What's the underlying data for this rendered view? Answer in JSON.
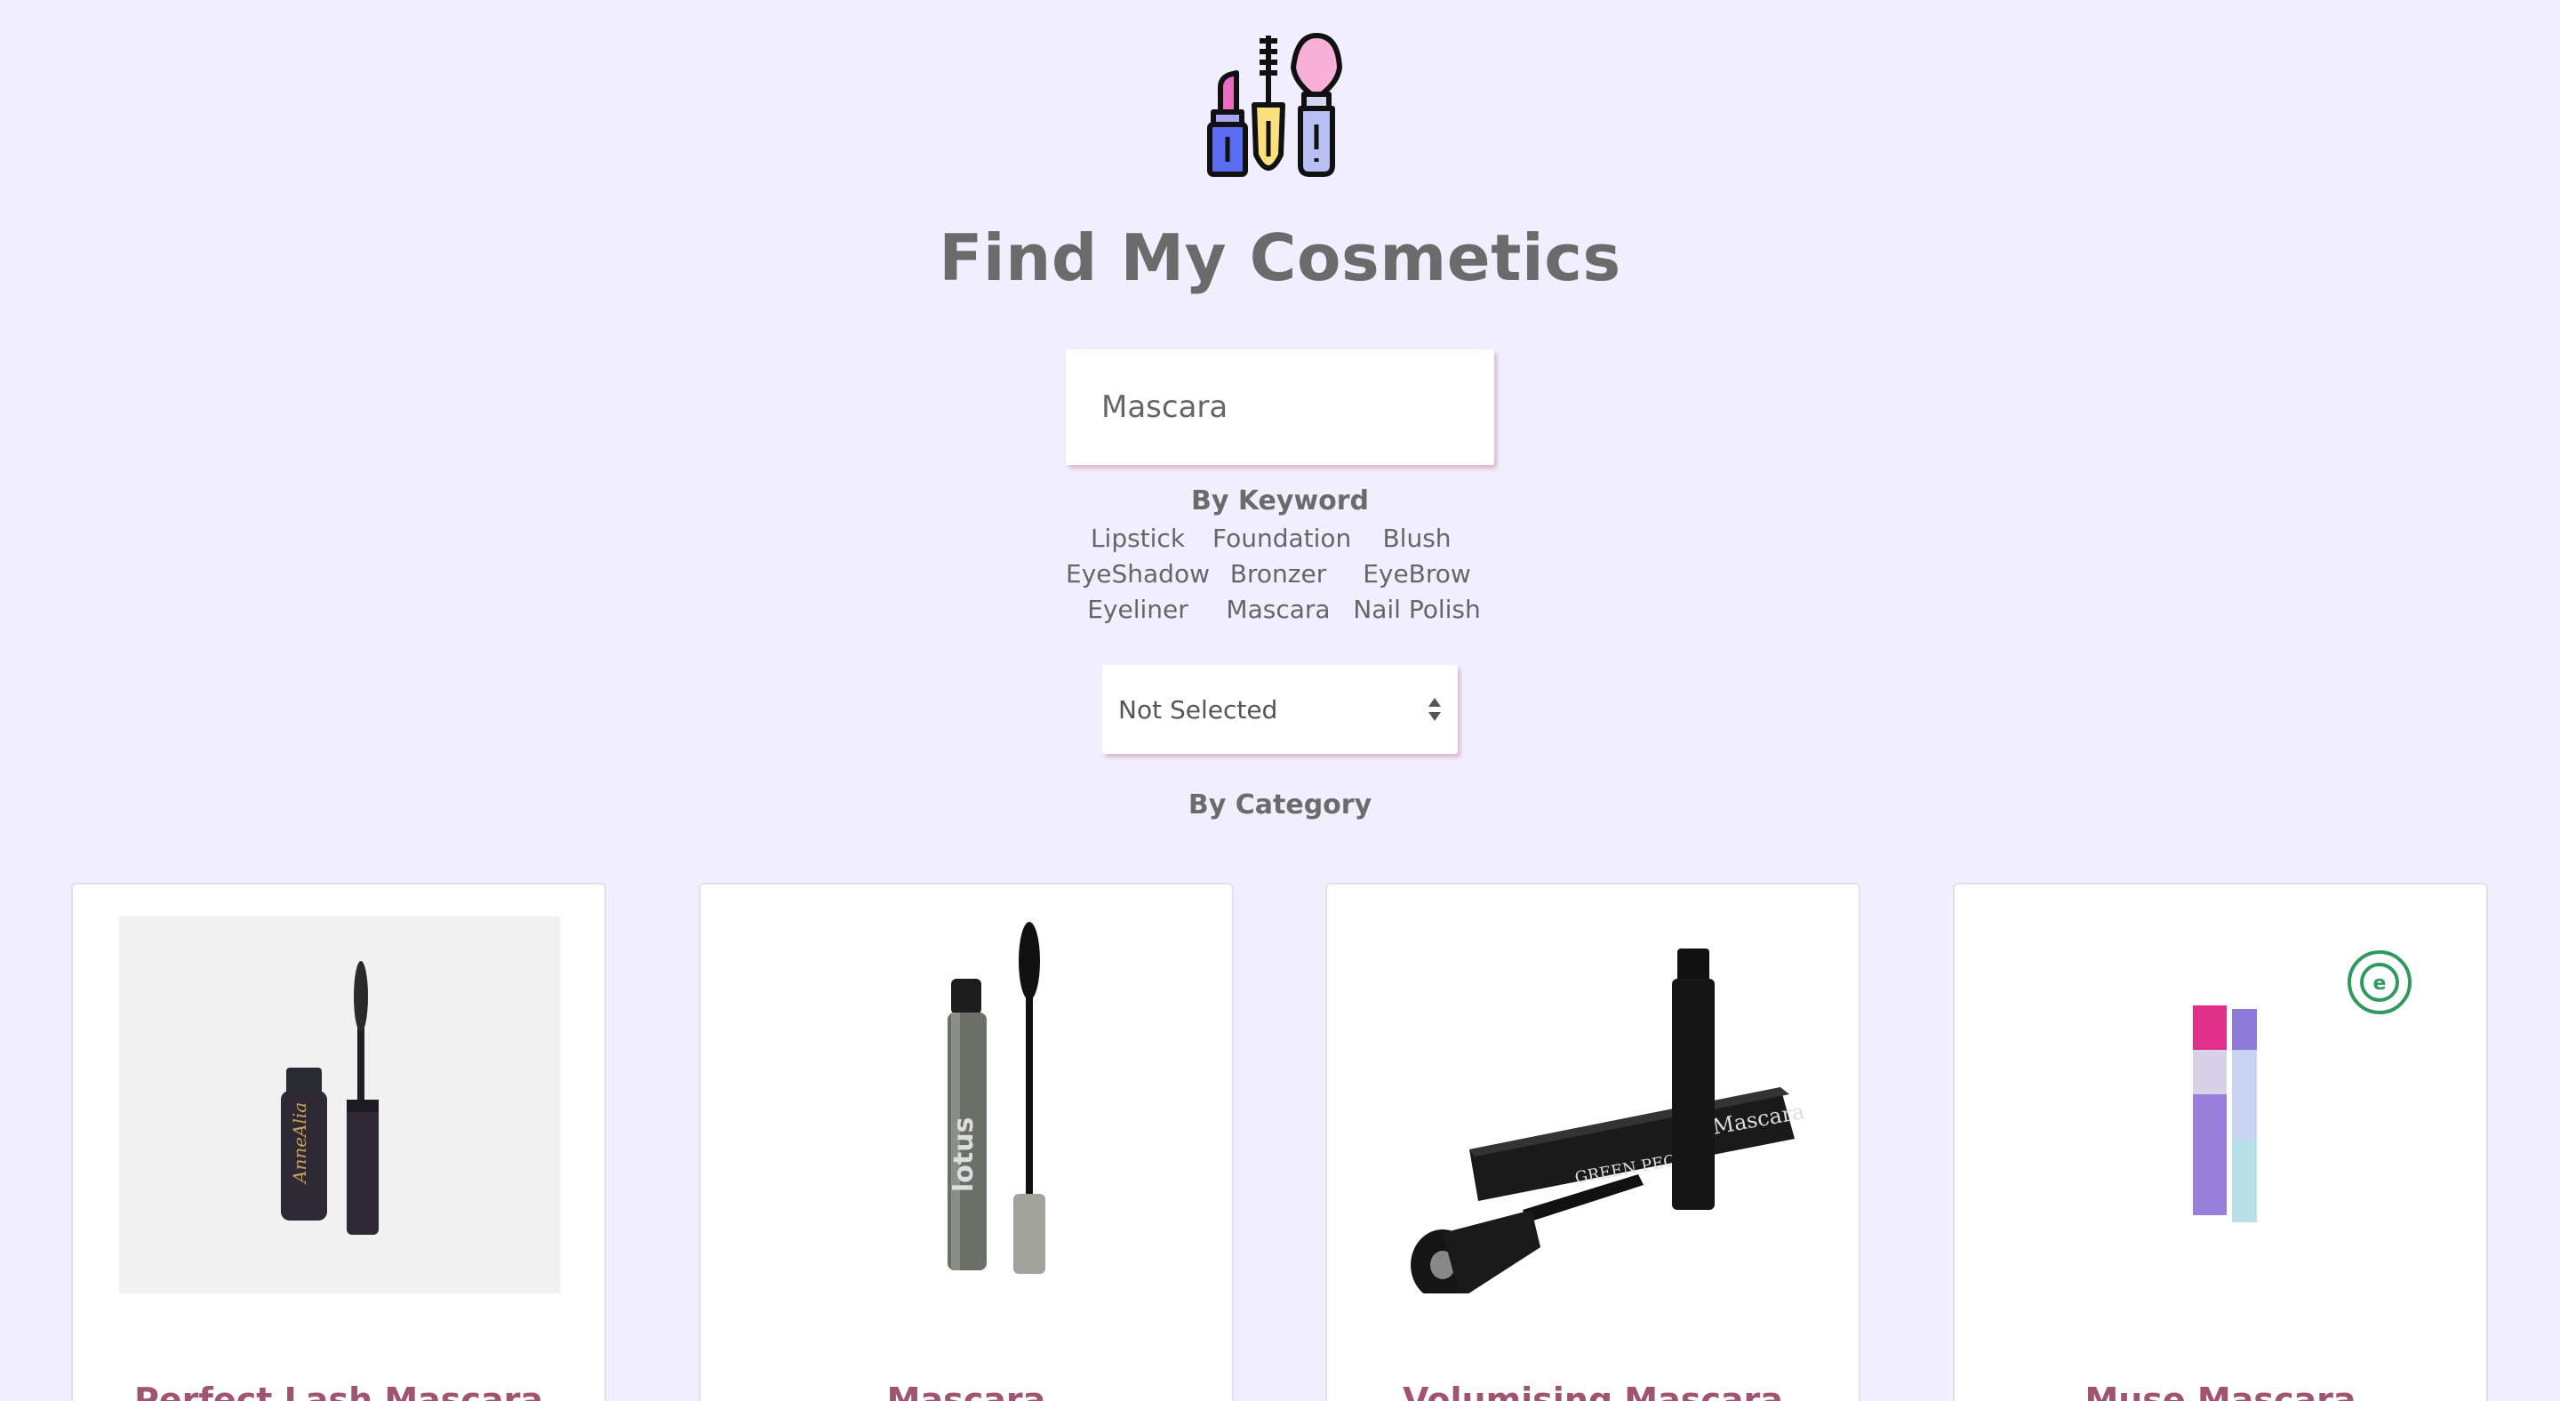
{
  "header": {
    "logo_icon": "makeup-logo-icon",
    "title": "Find My Cosmetics"
  },
  "search": {
    "value": "Mascara",
    "keyword_heading": "By Keyword",
    "keywords": [
      "Lipstick",
      "Foundation",
      "Blush",
      "EyeShadow",
      "Bronzer",
      "EyeBrow",
      "Eyeliner",
      "Mascara",
      "Nail Polish"
    ]
  },
  "category": {
    "selected": "Not Selected",
    "heading": "By Category"
  },
  "products": [
    {
      "name": "Perfect Lash Mascara",
      "image_icon": "mascara-image"
    },
    {
      "name": "Mascara",
      "image_icon": "mascara-image"
    },
    {
      "name": "Volumising Mascara",
      "image_icon": "mascara-image"
    },
    {
      "name": "Muse Mascara",
      "image_icon": "mascara-image"
    }
  ],
  "colors": {
    "background": "#f1effd",
    "accent": "#a0546f",
    "text": "#6b6b6b"
  }
}
